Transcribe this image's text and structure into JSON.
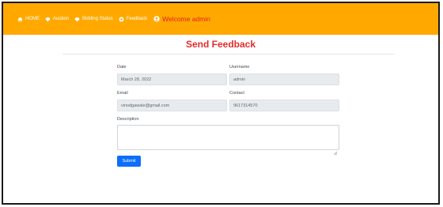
{
  "nav": {
    "items": [
      {
        "label": "HOME",
        "icon": "home-icon"
      },
      {
        "label": "Auction",
        "icon": "gavel-icon"
      },
      {
        "label": "Bidding Status",
        "icon": "gavel-icon"
      },
      {
        "label": "Feedback",
        "icon": "feedback-icon"
      }
    ],
    "welcome": "Welcome admin",
    "welcome_icon": "user-circle-icon"
  },
  "colors": {
    "navbar": "#ffa900",
    "title": "#e32b2b",
    "welcome": "#e32020",
    "button": "#0d6efd"
  },
  "form": {
    "title": "Send Feedback",
    "date": {
      "label": "Date",
      "value": "March 28, 2022"
    },
    "username": {
      "label": "Username",
      "value": "admin"
    },
    "email": {
      "label": "Email",
      "value": "vinodgawale@gmail.com"
    },
    "contact": {
      "label": "Contact",
      "value": "9617314570"
    },
    "description": {
      "label": "Description",
      "value": ""
    },
    "submit_label": "Submit"
  }
}
